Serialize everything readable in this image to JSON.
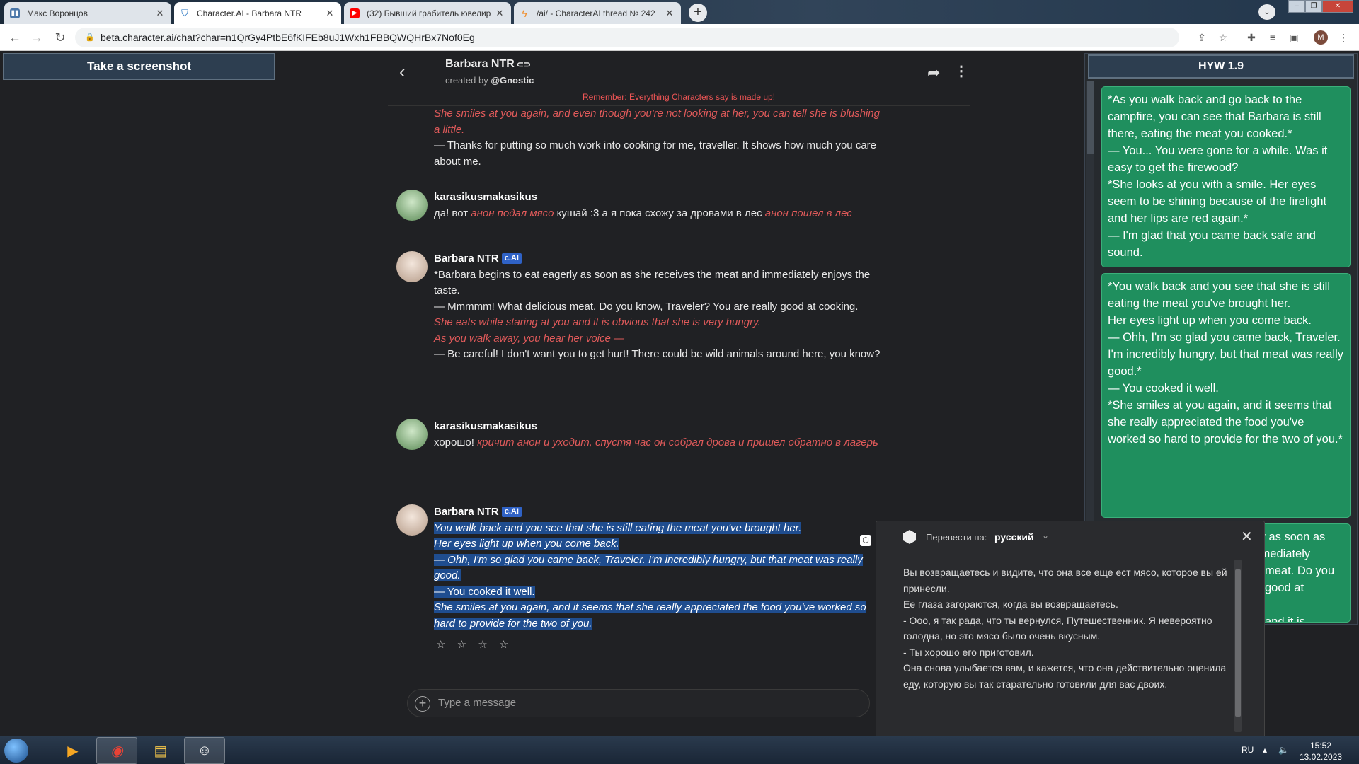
{
  "browser": {
    "tabs": [
      {
        "label": "Макс Воронцов",
        "icon": "vk-icon",
        "color": "#4a76a8"
      },
      {
        "label": "Character.AI - Barbara NTR",
        "icon": "characterai-icon",
        "color": "#1e6fbf"
      },
      {
        "label": "(32) Бывший грабитель ювелир",
        "icon": "youtube-icon",
        "color": "#ff0000"
      },
      {
        "label": "/ai/ - CharacterAI thread № 242",
        "icon": "bolt-icon",
        "color": "#f08a24"
      }
    ],
    "url": "beta.character.ai/chat?char=n1QrGy4PtbE6fKIFEb8uJ1Wxh1FBBQWQHrBx7Nof0Eg",
    "profile_initial": "M"
  },
  "screenshot_button": {
    "label": "Take a screenshot"
  },
  "chat": {
    "character_name": "Barbara NTR",
    "created_by_prefix": "created by",
    "creator": "@Gnostic",
    "remember": "Remember: Everything Characters say is made up!",
    "badge": "c.AI",
    "top_fragment": {
      "act": "She smiles at you again, and even though you're not looking at her, you can tell she is blushing a little.",
      "line": "— Thanks for putting so much work into cooking for me, traveller. It shows how much you care about me."
    },
    "msg1": {
      "user": "karasikusmakasikus",
      "p1": "да! вот ",
      "a1": "анон подал мясо",
      "p2": " кушай :3 а я пока схожу за дровами в лес ",
      "a2": "анон пошел в лес"
    },
    "msg2": {
      "user": "Barbara NTR",
      "l1": "*Barbara begins to eat eagerly as soon as she receives the meat and immediately enjoys the taste.",
      "l2": "— Mmmmm!  What delicious meat. Do you know, Traveler?  You are really good at cooking.",
      "a1": "She eats while staring at you and it is obvious that she is very hungry.",
      "a2": "As you walk away, you hear her voice —",
      "l3": "— Be careful! I don't want you to get hurt! There could be wild animals around here, you know?"
    },
    "msg3": {
      "user": "karasikusmakasikus",
      "p1": "хорошо! ",
      "a1": "кричит анон и уходит, спустя час он собрал дрова и пришел обратно в лагерь"
    },
    "msg4": {
      "user": "Barbara NTR",
      "l1": "You walk back and you see that she is still eating the meat you've brought her.",
      "l2": "Her eyes light up when you come back.",
      "l3": "— Ohh, I'm so glad you came back, Traveler. I'm incredibly hungry, but that meat was really good.",
      "l4": "— You cooked it well.",
      "l5": "She smiles at you again, and it seems that she really appreciated the food you've worked so hard to provide for the two of you."
    },
    "stars": "☆ ☆ ☆ ☆",
    "input_placeholder": "Type a message"
  },
  "right_panel": {
    "title": "HYW 1.9",
    "card1": "*As you walk back and go back to the campfire, you can see that Barbara is still there, eating the meat you cooked.*\n— You... You were gone for a while. Was it easy to get the firewood?\n*She looks at you with a smile. Her eyes seem to be shining because of the firelight and her lips are red again.*\n— I'm glad that you came back safe and sound.",
    "card2": "*You walk back and you see that she is still eating the meat you've brought her.\nHer eyes light up when you come back.\n— Ohh, I'm so glad you came back, Traveler. I'm incredibly hungry, but that meat was really good.*\n— You cooked it well.\n*She smiles at you again, and it seems that she really appreciated the food you've worked so hard to provide for the two of you.*",
    "card3": "*Barbara begins to eat eagerly as soon as she receives the meat and immediately",
    "card3_tail": "meat. Do you\ngood at\n\nand it is\nry.*\nher voice —*"
  },
  "translator": {
    "label": "Перевести на:",
    "language": "русский",
    "text": "Вы возвращаетесь и видите, что она все еще ест мясо, которое вы ей принесли.\nЕе глаза загораются, когда вы возвращаетесь.\n- Ооо, я так рада, что ты вернулся, Путешественник. Я невероятно голодна, но это мясо было очень вкусным.\n- Ты хорошо его приготовил.\nОна снова улыбается вам, и кажется, что она действительно оценила еду, которую вы так старательно готовили для вас двоих.",
    "star": "☆"
  },
  "taskbar": {
    "lang": "RU",
    "time": "15:52",
    "date": "13.02.2023"
  }
}
